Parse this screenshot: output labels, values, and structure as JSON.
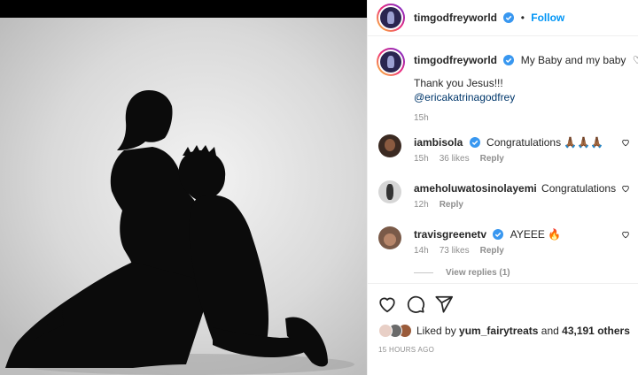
{
  "post": {
    "author": "timgodfreyworld",
    "follow_label": "Follow",
    "separator": "•",
    "caption_text": "My Baby and my baby",
    "caption_hearts": "♡♡♡",
    "caption_line2": "Thank you Jesus!!!",
    "caption_mention": "@ericakatrinagodfrey",
    "caption_time": "15h"
  },
  "comments": [
    {
      "user": "iambisola",
      "verified": true,
      "text": "Congratulations 🙏🏾🙏🏾🙏🏾",
      "time": "15h",
      "likes": "36 likes",
      "reply": "Reply"
    },
    {
      "user": "ameholuwatosinolayemi",
      "verified": false,
      "text": "Congratulations",
      "time": "12h",
      "likes": "",
      "reply": "Reply"
    },
    {
      "user": "travisgreenetv",
      "verified": true,
      "text": "AYEEE 🔥",
      "time": "14h",
      "likes": "73 likes",
      "reply": "Reply"
    }
  ],
  "view_replies": "View replies (1)",
  "likes": {
    "prefix": "Liked by",
    "user": "yum_fairytreats",
    "middle": "and",
    "count": "43,191 others"
  },
  "timestamp": "15 HOURS AGO",
  "icons": {
    "like": "heart-icon",
    "comment": "comment-icon",
    "share": "share-icon",
    "verified": "verified-badge-icon"
  },
  "colors": {
    "accent": "#0095f6",
    "verified": "#3897f0",
    "muted": "#8e8e8e"
  }
}
